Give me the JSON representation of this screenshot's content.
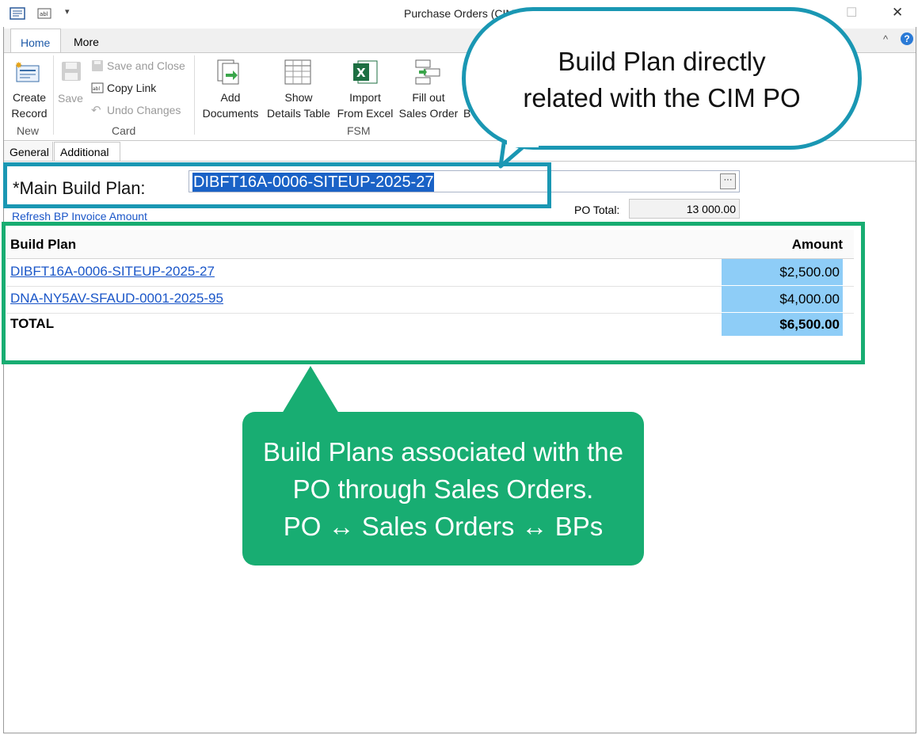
{
  "window": {
    "title": "Purchase Orders (CIM)",
    "controls": {
      "minimize": "—",
      "maximize": "☐",
      "close": "✕"
    }
  },
  "ribbon": {
    "tabs": [
      {
        "label": "Home"
      },
      {
        "label": "More"
      }
    ],
    "new_group": {
      "create_record_line1": "Create",
      "create_record_line2": "Record",
      "label": "New"
    },
    "card_group": {
      "save": "Save",
      "save_and_close": "Save and Close",
      "copy_link": "Copy Link",
      "undo_changes": "Undo Changes",
      "label": "Card"
    },
    "fsm_group": {
      "add_documents_line1": "Add",
      "add_documents_line2": "Documents",
      "show_details_line1": "Show",
      "show_details_line2": "Details Table",
      "import_line1": "Import",
      "import_line2": "From Excel",
      "fill_out_line1": "Fill out",
      "fill_out_line2": "Sales Order",
      "partial_line2": "B",
      "label": "FSM"
    },
    "collapse_icon": "^",
    "help_icon": "?"
  },
  "content_tabs": [
    {
      "label": "General"
    },
    {
      "label": "Additional"
    }
  ],
  "main_build_plan": {
    "label": "*Main Build Plan:",
    "value": "DIBFT16A-0006-SITEUP-2025-27",
    "ellipsis": "···"
  },
  "refresh_link": "Refresh BP Invoice Amount",
  "po_total": {
    "label": "PO Total:",
    "value": "13 000.00"
  },
  "grid": {
    "columns": {
      "build_plan": "Build Plan",
      "amount": "Amount"
    },
    "rows": [
      {
        "build_plan": "DIBFT16A-0006-SITEUP-2025-27",
        "amount": "$2,500.00"
      },
      {
        "build_plan": "DNA-NY5AV-SFAUD-0001-2025-95",
        "amount": "$4,000.00"
      }
    ],
    "total": {
      "label": "TOTAL",
      "amount": "$6,500.00"
    }
  },
  "callouts": {
    "teal_line1": "Build Plan directly",
    "teal_line2": "related with the CIM PO",
    "green_line1": "Build Plans associated with the",
    "green_line2": "PO through Sales Orders.",
    "green_line3": "PO ↔ Sales Orders ↔ BPs"
  },
  "colors": {
    "teal": "#1a97b3",
    "green": "#18ad72",
    "amount_fill": "#8ecdf7",
    "link": "#1a56c8",
    "selection": "#1a62c6"
  }
}
